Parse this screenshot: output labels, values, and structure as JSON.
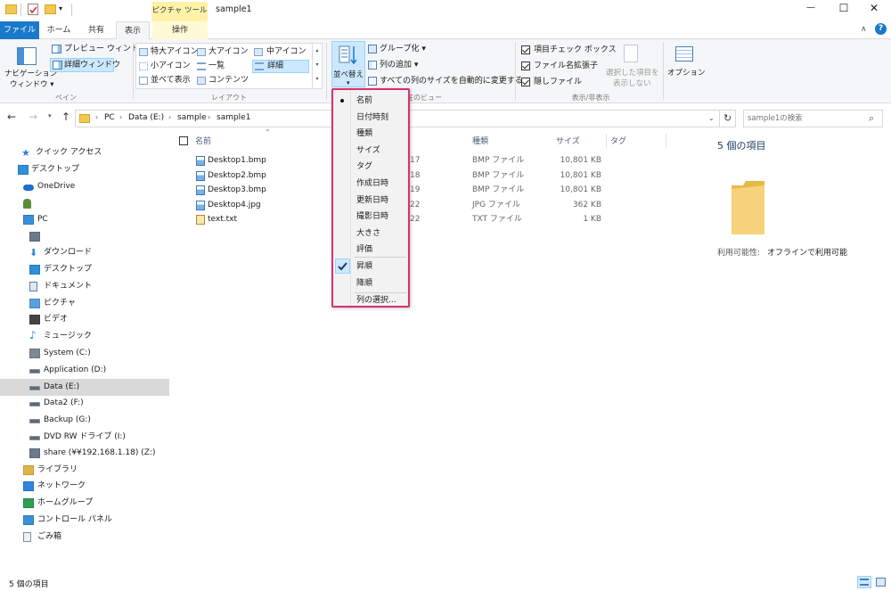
{
  "window": {
    "title": "sample1",
    "contextual_tab_group": "ピクチャ ツール",
    "minimize_label": "—",
    "maximize_label": "☐",
    "close_label": "✕",
    "help_label": "?",
    "ribbon_collapse_label": "∧"
  },
  "tabs": {
    "file": "ファイル",
    "home": "ホーム",
    "share": "共有",
    "view": "表示",
    "manage": "操作"
  },
  "ribbon": {
    "pane": {
      "nav_pane_line1": "ナビゲーション",
      "nav_pane_line2": "ウィンドウ ▾",
      "preview_pane": "プレビュー ウィンドウ",
      "details_pane": "詳細ウィンドウ",
      "group_label": "ペイン"
    },
    "layout": {
      "extra_large_icons": "特大アイコン",
      "large_icons": "大アイコン",
      "medium_icons": "中アイコン",
      "small_icons": "小アイコン",
      "list": "一覧",
      "details": "詳細",
      "tiles": "並べて表示",
      "content": "コンテンツ",
      "group_label": "レイアウト"
    },
    "current_view": {
      "sort_by": "並べ替え",
      "group_by": "グループ化 ▾",
      "add_columns": "列の追加 ▾",
      "size_all_columns": "すべての列のサイズを自動的に変更する",
      "group_label_partial": "在のビュー"
    },
    "show_hide": {
      "item_checkboxes": "項目チェック ボックス",
      "file_name_extensions": "ファイル名拡張子",
      "hidden_items": "隠しファイル",
      "hide_selected_line1": "選択した項目を",
      "hide_selected_line2": "表示しない",
      "group_label": "表示/非表示"
    },
    "options": "オプション"
  },
  "address": {
    "crumbs": [
      "PC",
      "Data (E:)",
      "sample",
      "sample1"
    ],
    "search_placeholder": "sample1の検索"
  },
  "sidebar": {
    "items": [
      {
        "label": "クイック アクセス",
        "icon": "star-icon"
      },
      {
        "label": "デスクトップ",
        "icon": "desktop-icon"
      },
      {
        "label": "OneDrive",
        "icon": "cloud-icon"
      },
      {
        "label": "",
        "icon": "user-icon"
      },
      {
        "label": "PC",
        "icon": "computer-icon"
      },
      {
        "label": "",
        "icon": "network-drive-icon"
      },
      {
        "label": "ダウンロード",
        "icon": "download-icon"
      },
      {
        "label": "デスクトップ",
        "icon": "desktop-icon"
      },
      {
        "label": "ドキュメント",
        "icon": "document-icon"
      },
      {
        "label": "ピクチャ",
        "icon": "picture-icon"
      },
      {
        "label": "ビデオ",
        "icon": "video-icon"
      },
      {
        "label": "ミュージック",
        "icon": "music-icon"
      },
      {
        "label": "System (C:)",
        "icon": "windows-drive-icon"
      },
      {
        "label": "Application (D:)",
        "icon": "drive-icon"
      },
      {
        "label": "Data (E:)",
        "icon": "drive-icon"
      },
      {
        "label": "Data2 (F:)",
        "icon": "drive-icon"
      },
      {
        "label": "Backup (G:)",
        "icon": "drive-icon"
      },
      {
        "label": "DVD RW ドライブ (I:)",
        "icon": "dvd-icon"
      },
      {
        "label": "share (¥¥192.168.1.18) (Z:)",
        "icon": "network-drive-icon"
      },
      {
        "label": "ライブラリ",
        "icon": "library-icon"
      },
      {
        "label": "ネットワーク",
        "icon": "network-icon"
      },
      {
        "label": "ホームグループ",
        "icon": "homegroup-icon"
      },
      {
        "label": "コントロール パネル",
        "icon": "control-panel-icon"
      },
      {
        "label": "ごみ箱",
        "icon": "recycle-bin-icon"
      }
    ],
    "selected_index": 14
  },
  "columns": {
    "name": "名前",
    "type": "種類",
    "size": "サイズ",
    "tags": "タグ"
  },
  "files": [
    {
      "name": "Desktop1.bmp",
      "date_partial": ":17",
      "type": "BMP ファイル",
      "size": "10,801 KB"
    },
    {
      "name": "Desktop2.bmp",
      "date_partial": ":18",
      "type": "BMP ファイル",
      "size": "10,801 KB"
    },
    {
      "name": "Desktop3.bmp",
      "date_partial": ":19",
      "type": "BMP ファイル",
      "size": "10,801 KB"
    },
    {
      "name": "Desktop4.jpg",
      "date_partial": ":22",
      "type": "JPG ファイル",
      "size": "362 KB"
    },
    {
      "name": "text.txt",
      "date_partial": ":22",
      "type": "TXT ファイル",
      "size": "1 KB"
    }
  ],
  "sort_menu": {
    "items": [
      "名前",
      "日付時刻",
      "種類",
      "サイズ",
      "タグ",
      "作成日時",
      "更新日時",
      "撮影日時",
      "大きさ",
      "評価"
    ],
    "ascending": "昇順",
    "descending": "降順",
    "choose_columns": "列の選択..."
  },
  "details_pane": {
    "count": "5 個の項目",
    "availability_label": "利用可能性:",
    "availability_value": "オフラインで利用可能"
  },
  "status": {
    "count": "5 個の項目"
  },
  "colors": {
    "accent": "#1979ca",
    "menu_border": "#d6316f",
    "selection": "#cce8ff",
    "contextual_tab": "#fff2a8"
  }
}
